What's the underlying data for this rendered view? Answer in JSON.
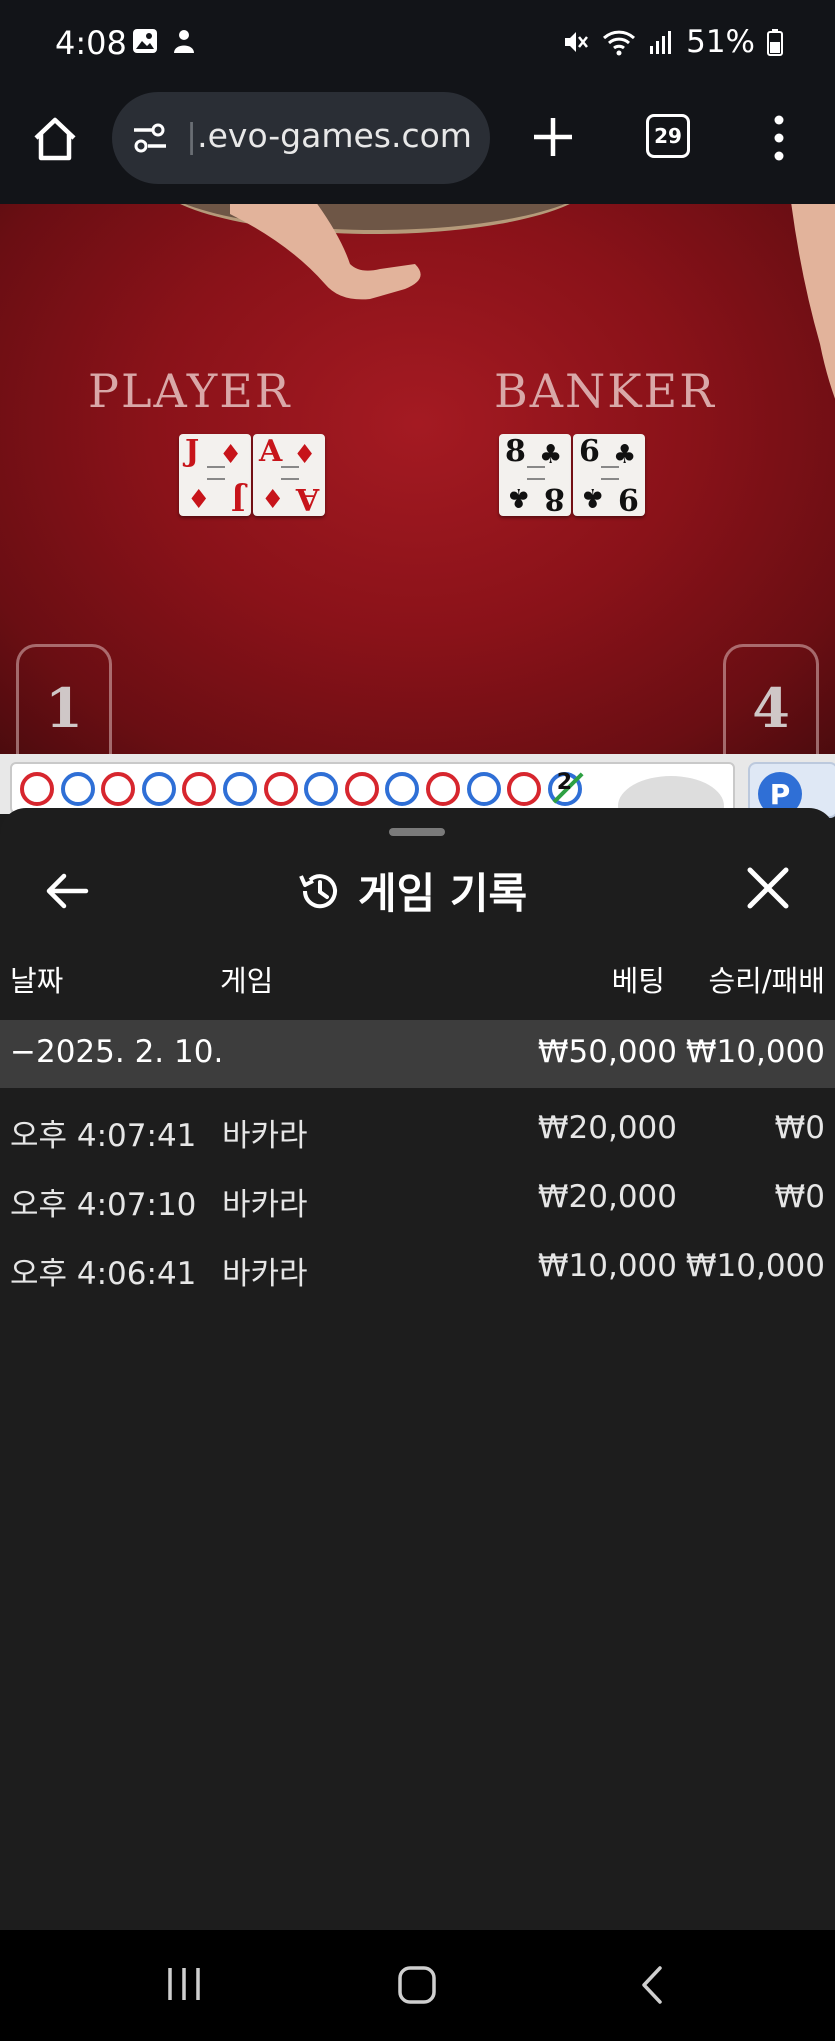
{
  "status_bar": {
    "time": "4:08",
    "battery": "51%",
    "left_icons": [
      "gallery-icon",
      "person-notification-icon"
    ],
    "right_icons": [
      "mute-icon",
      "wifi-icon",
      "signal-icon",
      "battery-icon"
    ]
  },
  "browser": {
    "url_faded": "|",
    "url": ".evo-games.com",
    "tab_count": "29"
  },
  "game": {
    "player_label": "PLAYER",
    "banker_label": "BANKER",
    "player_score": "1",
    "banker_score": "4",
    "player_cards": [
      {
        "rank": "J",
        "suit": "♦",
        "color": "#c7141a"
      },
      {
        "rank": "A",
        "suit": "♦",
        "color": "#c7141a"
      }
    ],
    "banker_cards": [
      {
        "rank": "8",
        "suit": "♣",
        "color": "#111111"
      },
      {
        "rank": "6",
        "suit": "♣",
        "color": "#111111"
      }
    ],
    "banker_card_bottoms": [
      "8",
      "9"
    ],
    "road_beads": [
      "r",
      "b",
      "r",
      "b",
      "r",
      "b",
      "r",
      "b",
      "r",
      "b",
      "r",
      "b",
      "r",
      "b"
    ],
    "road_tie_count": "2",
    "p_badge": "P"
  },
  "history": {
    "title": "게임 기록",
    "columns": {
      "date": "날짜",
      "game": "게임",
      "bet": "베팅",
      "result": "승리/패배"
    },
    "summary": {
      "date": "−2025. 2. 10.",
      "bet": "₩50,000",
      "result": "₩10,000"
    },
    "rows": [
      {
        "time": "오후 4:07:41",
        "game": "바카라",
        "bet": "₩20,000",
        "result": "₩0"
      },
      {
        "time": "오후 4:07:10",
        "game": "바카라",
        "bet": "₩20,000",
        "result": "₩0"
      },
      {
        "time": "오후 4:06:41",
        "game": "바카라",
        "bet": "₩10,000",
        "result": "₩10,000"
      }
    ]
  },
  "colors": {
    "sheet_bg": "#1d1d1d",
    "summary_bg": "#3d3d3d",
    "felt": "#8a1219",
    "player_bead": "#2f6fd6",
    "banker_bead": "#d7262e"
  }
}
